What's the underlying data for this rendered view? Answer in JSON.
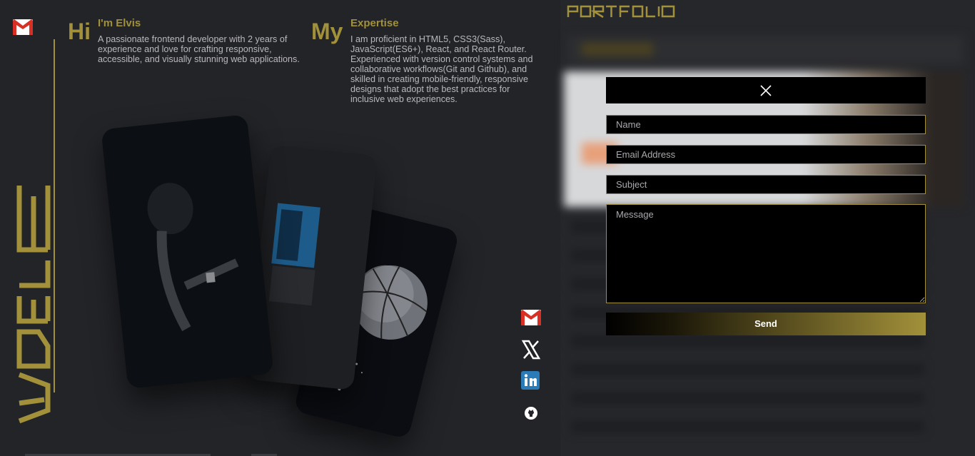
{
  "theme": {
    "accent": "#a2913a",
    "background": "#232428",
    "text": "#b9b9bd"
  },
  "intro": {
    "hi": "Hi",
    "title": "I'm Elvis",
    "text": "A passionate frontend developer with 2 years of experience and love for crafting responsive, accessible, and visually stunning web applications."
  },
  "expertise": {
    "my": "My",
    "title": "Expertise",
    "text": "I am proficient in HTML5, CSS3(Sass), JavaScript(ES6+), React, and React Router. Experienced with version control systems and collaborative workflows(Git and Github), and skilled in creating mobile-friendly, responsive designs that adopt the best practices for inclusive web experiences."
  },
  "brand": {
    "vertical_logo": "ADELE",
    "portfolio_logo": "PORTFOLIO"
  },
  "cards": [
    {
      "icon": "person-photo"
    },
    {
      "icon": "laptop-photo"
    },
    {
      "icon": "basketball-photo"
    }
  ],
  "social": [
    "gmail-icon",
    "x-icon",
    "linkedin-icon",
    "github-icon"
  ],
  "contact_form": {
    "name_placeholder": "Name",
    "email_placeholder": "Email Address",
    "subject_placeholder": "Subject",
    "message_placeholder": "Message",
    "send_label": "Send"
  }
}
